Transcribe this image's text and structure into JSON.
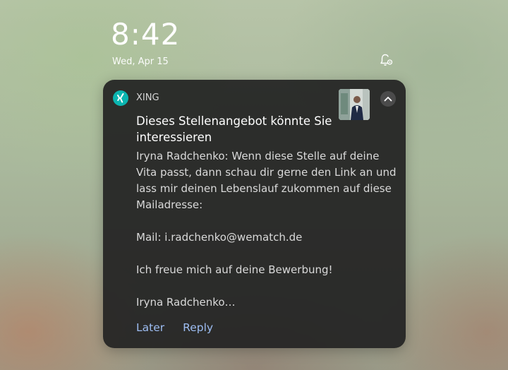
{
  "lockscreen": {
    "time": "8:42",
    "date": "Wed, Apr 15"
  },
  "notification": {
    "app_name": "XING",
    "app_color": "#0bb5b0",
    "title": "Dieses Stellenangebot könnte Sie interessieren",
    "body_lines": [
      "Iryna Radchenko: Wenn diese Stelle auf deine Vita passt, dann schau dir gerne den Link an und lass mir deinen Lebenslauf zukommen auf diese Mailadresse:",
      "Mail: i.radchenko@wematch.de",
      "Ich freue mich auf deine Bewerbung!",
      "Iryna Radchenko…"
    ],
    "actions": {
      "later": "Later",
      "reply": "Reply"
    },
    "action_color": "#9dbdf2"
  },
  "icons": {
    "status": "notification-settings-icon",
    "app": "xing-logo-icon",
    "collapse": "chevron-up-icon",
    "thumbnail": "profile-thumbnail"
  }
}
